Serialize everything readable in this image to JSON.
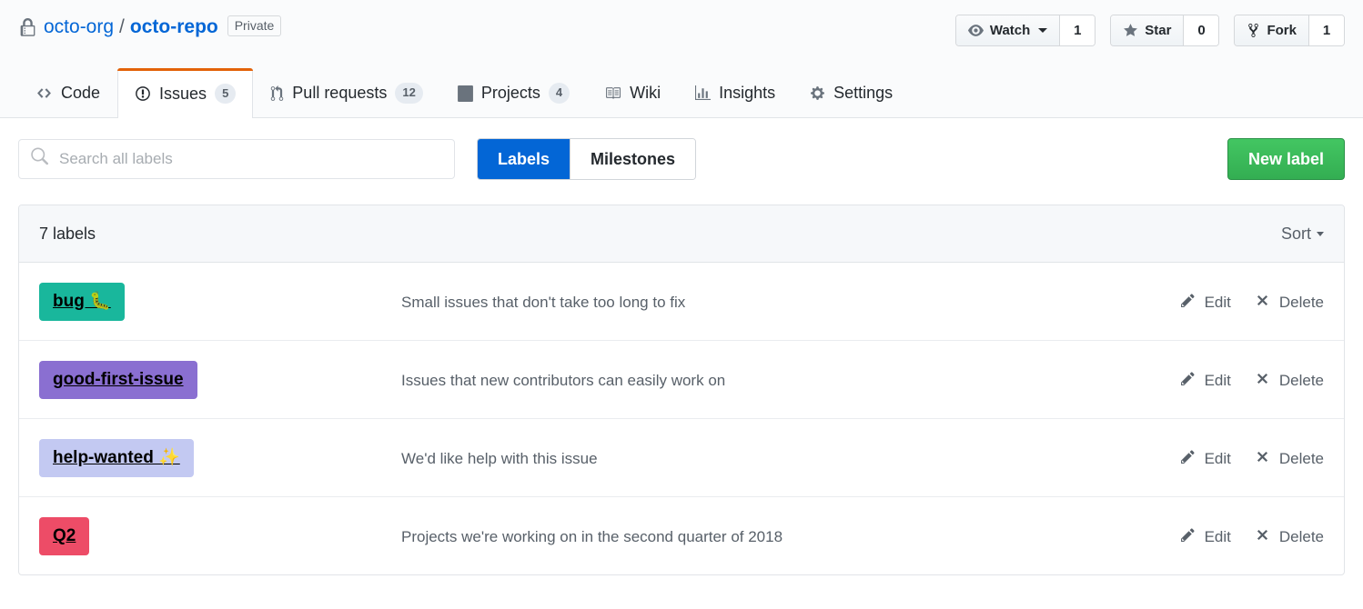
{
  "repo": {
    "visibility_icon": "lock-icon",
    "owner": "octo-org",
    "separator": "/",
    "name": "octo-repo",
    "private_badge": "Private"
  },
  "header_actions": [
    {
      "icon": "eye-icon",
      "label": "Watch",
      "has_caret": true,
      "count": "1"
    },
    {
      "icon": "star-icon",
      "label": "Star",
      "has_caret": false,
      "count": "0"
    },
    {
      "icon": "fork-icon",
      "label": "Fork",
      "has_caret": false,
      "count": "1"
    }
  ],
  "nav_tabs": [
    {
      "icon": "code-icon",
      "label": "Code",
      "counter": "",
      "selected": false
    },
    {
      "icon": "issue-opened-icon",
      "label": "Issues",
      "counter": "5",
      "selected": true
    },
    {
      "icon": "git-pull-request-icon",
      "label": "Pull requests",
      "counter": "12",
      "selected": false
    },
    {
      "icon": "project-icon",
      "label": "Projects",
      "counter": "4",
      "selected": false
    },
    {
      "icon": "book-icon",
      "label": "Wiki",
      "counter": "",
      "selected": false
    },
    {
      "icon": "graph-icon",
      "label": "Insights",
      "counter": "",
      "selected": false
    },
    {
      "icon": "gear-icon",
      "label": "Settings",
      "counter": "",
      "selected": false
    }
  ],
  "subnav": {
    "search": {
      "value": "",
      "placeholder": "Search all labels",
      "icon": "search-icon"
    },
    "segments": [
      {
        "label": "Labels",
        "active": true
      },
      {
        "label": "Milestones",
        "active": false
      }
    ],
    "new_label_button": "New label"
  },
  "labels_box": {
    "count_text": "7 labels",
    "sort_label": "Sort",
    "edit_label": "Edit",
    "delete_label": "Delete",
    "edit_icon": "pencil-icon",
    "delete_icon": "x-icon",
    "rows": [
      {
        "name": "bug 🐛",
        "color": "#19b79c",
        "text_color": "#000000",
        "description": "Small issues that don't take too long to fix"
      },
      {
        "name": "good-first-issue",
        "color": "#8a6fd1",
        "text_color": "#000000",
        "description": "Issues that new contributors can easily work on"
      },
      {
        "name": "help-wanted ✨",
        "color": "#c3c9f2",
        "text_color": "#000000",
        "description": "We'd like help with this issue"
      },
      {
        "name": "Q2",
        "color": "#ed4c67",
        "text_color": "#000000",
        "description": "Projects we're working on in the second quarter of 2018"
      }
    ]
  },
  "colors": {
    "accent_blue": "#0366d6",
    "selected_tab_underline": "#e36209",
    "new_label_green": "#33ae52",
    "border": "#e1e4e8",
    "header_bg": "#fafbfc"
  }
}
